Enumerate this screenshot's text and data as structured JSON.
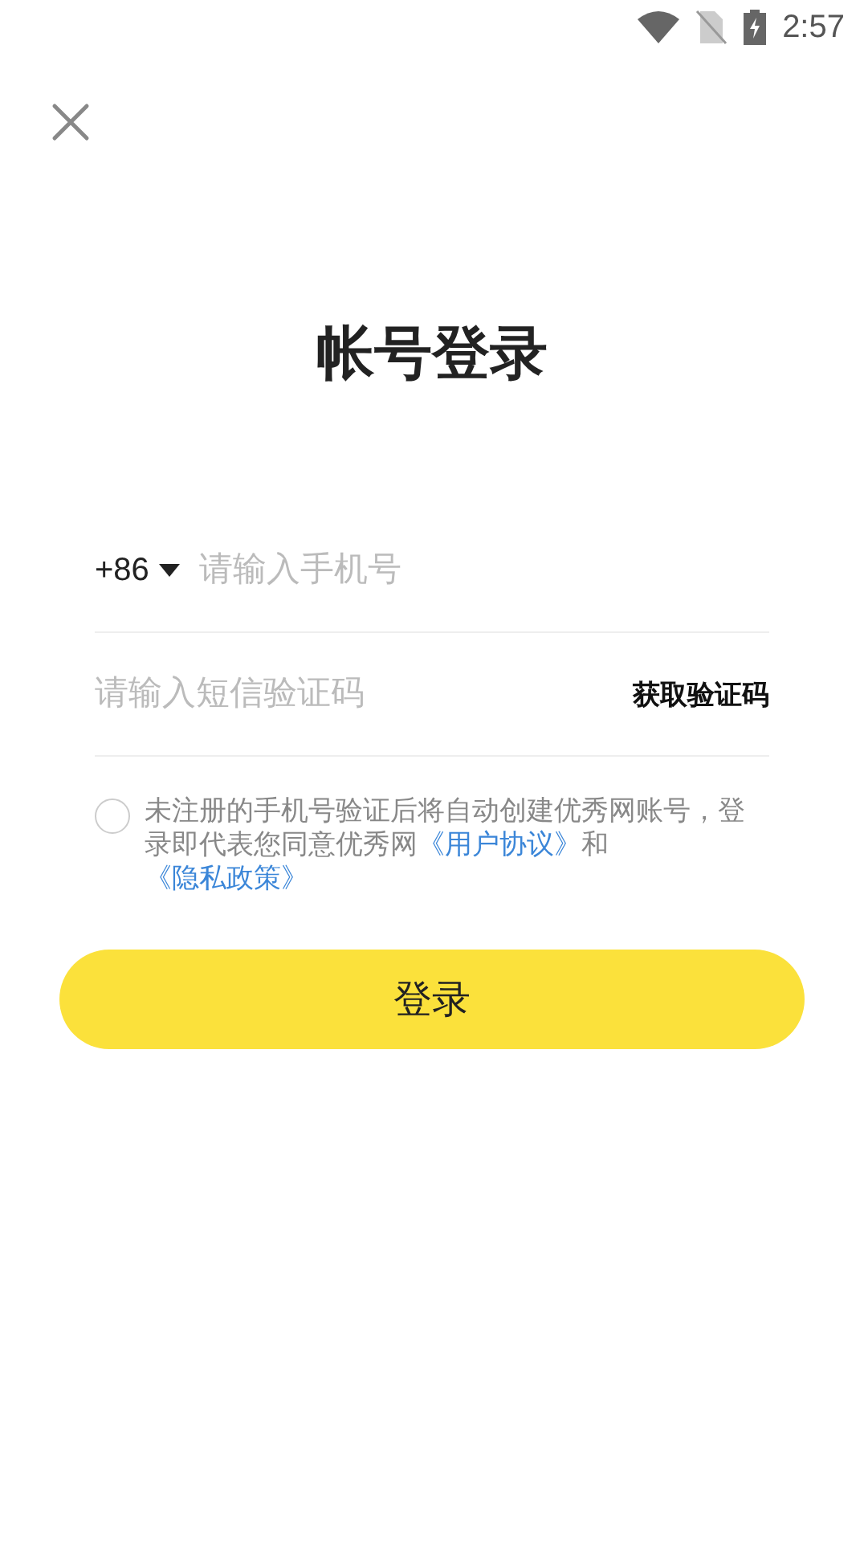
{
  "status_bar": {
    "time": "2:57"
  },
  "title": "帐号登录",
  "phone_field": {
    "country_code": "+86",
    "placeholder": "请输入手机号"
  },
  "code_field": {
    "placeholder": "请输入短信验证码",
    "button": "获取验证码"
  },
  "agreement": {
    "checked": false,
    "parts": [
      {
        "kind": "text",
        "text": "未注册的手机号验证后将自动创建优秀网账号，登录即代表您同意优秀网"
      },
      {
        "kind": "link",
        "text": "《用户协议》"
      },
      {
        "kind": "text",
        "text": "和"
      },
      {
        "kind": "link",
        "text": "《隐私政策》"
      }
    ]
  },
  "login_button": "登录"
}
